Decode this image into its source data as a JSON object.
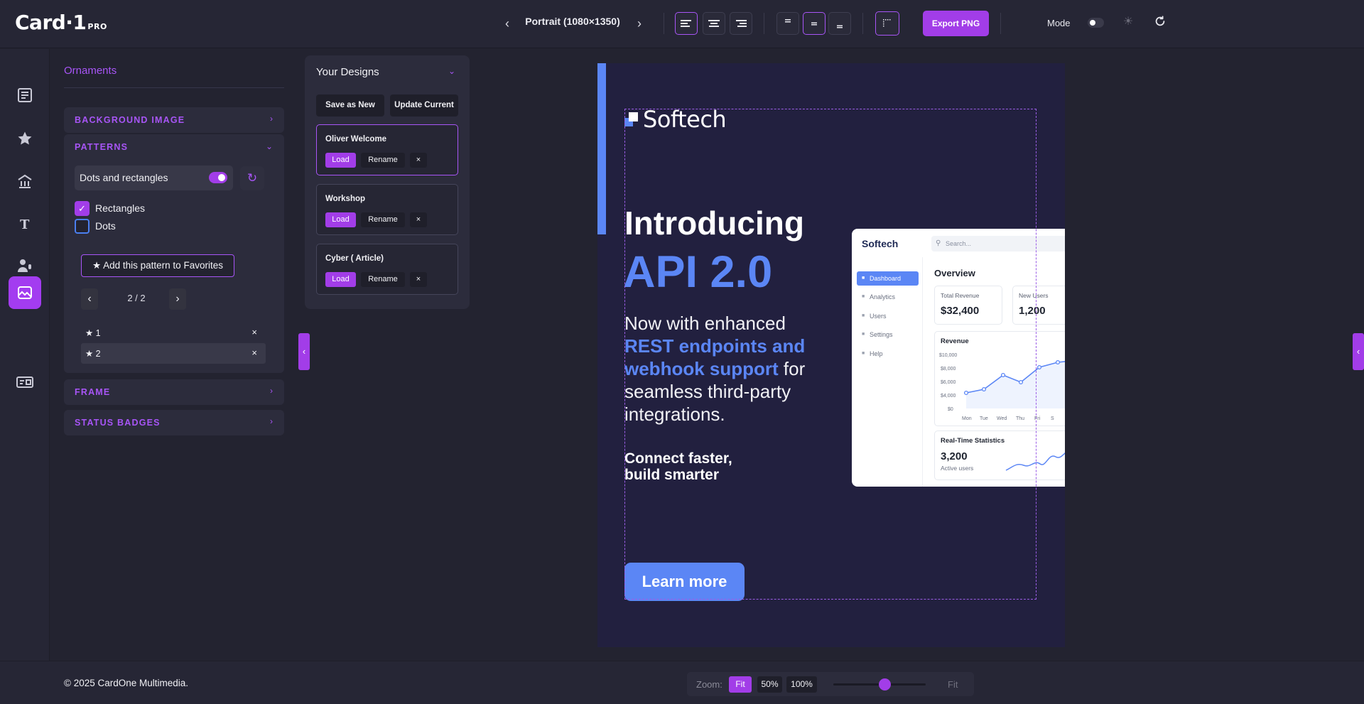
{
  "app": {
    "logo": "Card·1",
    "logo_badge": "PRO"
  },
  "toolbar": {
    "size_label": "Portrait (1080×1350)",
    "prev_icon": "chevron-left-icon",
    "next_icon": "chevron-right-icon",
    "export_label": "Export PNG",
    "mode_label": "Mode",
    "accent_color": "#a23de8"
  },
  "rail": {
    "items": [
      {
        "name": "text-list-icon"
      },
      {
        "name": "star-icon"
      },
      {
        "name": "building-icon"
      },
      {
        "name": "typography-icon"
      },
      {
        "name": "speaker-icon"
      },
      {
        "name": "image-icon",
        "active": true
      },
      {
        "name": "id-card-icon"
      }
    ]
  },
  "ornaments": {
    "title": "Ornaments",
    "sections": {
      "background_image": "BACKGROUND IMAGE",
      "patterns": "PATTERNS",
      "frame": "FRAME",
      "status_badges": "STATUS BADGES"
    },
    "pattern_name": "Dots and rectangles",
    "pattern_enabled": true,
    "reset_icon": "↻",
    "options": [
      {
        "label": "Rectangles",
        "checked": true
      },
      {
        "label": "Dots",
        "checked": false
      }
    ],
    "favorite_button": "★ Add this pattern to Favorites",
    "pagination": "2 / 2",
    "favorites": [
      {
        "label": "★ 1"
      },
      {
        "label": "★ 2"
      }
    ]
  },
  "designs": {
    "title": "Your Designs",
    "save_new": "Save as New",
    "update_current": "Update Current",
    "items": [
      {
        "name": "Oliver Welcome",
        "active": true
      },
      {
        "name": "Workshop"
      },
      {
        "name": "Cyber ( Article)"
      }
    ],
    "load_label": "Load",
    "rename_label": "Rename",
    "delete_label": "×"
  },
  "canvas": {
    "brand": "Softech",
    "headline": "Introducing",
    "headline_accent": "API 2.0",
    "body_prefix": "Now with enhanced ",
    "body_highlight": "REST endpoints and webhook support",
    "body_suffix": " for seamless third-party integrations.",
    "tagline_1": "Connect faster,",
    "tagline_2": "build smarter",
    "cta": "Learn more",
    "bg_color": "#22203f",
    "accent_color": "#5b86f5"
  },
  "dashboard": {
    "brand": "Softech",
    "search_placeholder": "Search...",
    "nav": [
      "Dashboard",
      "Analytics",
      "Users",
      "Settings",
      "Help"
    ],
    "overview": "Overview",
    "kpis": [
      {
        "label": "Total Revenue",
        "value": "$32,400"
      },
      {
        "label": "New Users",
        "value": "1,200"
      }
    ],
    "revenue_title": "Revenue",
    "revenue_y_ticks": [
      "$10,000",
      "$8,000",
      "$6,000",
      "$4,000",
      "$0"
    ],
    "revenue_x_ticks": [
      "Mon",
      "Tue",
      "Wed",
      "Thu",
      "Fri",
      "S"
    ],
    "rts_title": "Real-Time Statistics",
    "rts_value": "3,200",
    "rts_sub": "Active users"
  },
  "footer": {
    "copyright": "© 2025 CardOne Multimedia.",
    "zoom_label": "Zoom:",
    "zoom_options": [
      "Fit",
      "50%",
      "100%"
    ],
    "zoom_active": "Fit",
    "zoom_fit_label": "Fit"
  }
}
